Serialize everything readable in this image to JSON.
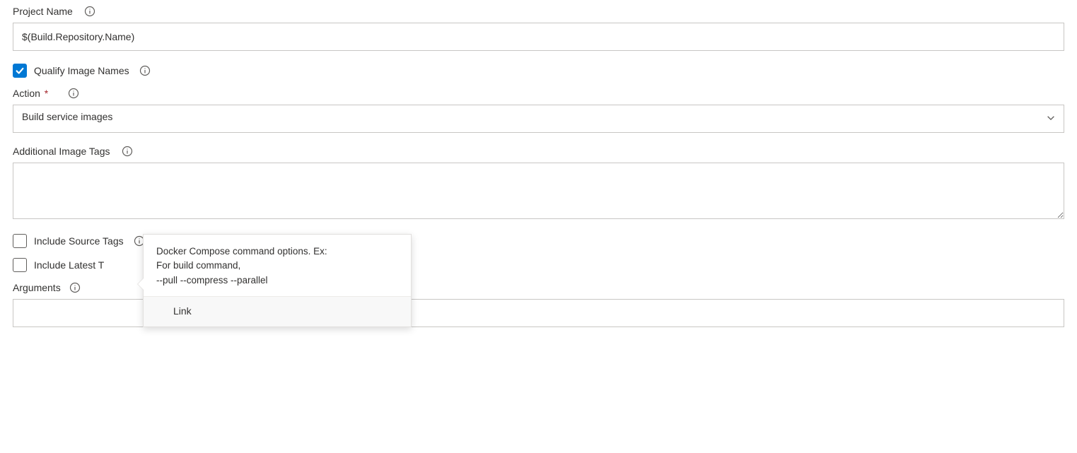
{
  "projectName": {
    "label": "Project Name",
    "value": "$(Build.Repository.Name)"
  },
  "qualifyImageNames": {
    "label": "Qualify Image Names",
    "checked": true
  },
  "action": {
    "label": "Action",
    "value": "Build service images"
  },
  "additionalImageTags": {
    "label": "Additional Image Tags",
    "value": ""
  },
  "includeSourceTags": {
    "label": "Include Source Tags",
    "checked": false
  },
  "includeLatestTag": {
    "label": "Include Latest T",
    "checked": false
  },
  "arguments": {
    "label": "Arguments",
    "value": ""
  },
  "tooltip": {
    "line1": "Docker Compose command options. Ex:",
    "line2": "For build command,",
    "line3": "--pull --compress --parallel",
    "link": "Link"
  }
}
